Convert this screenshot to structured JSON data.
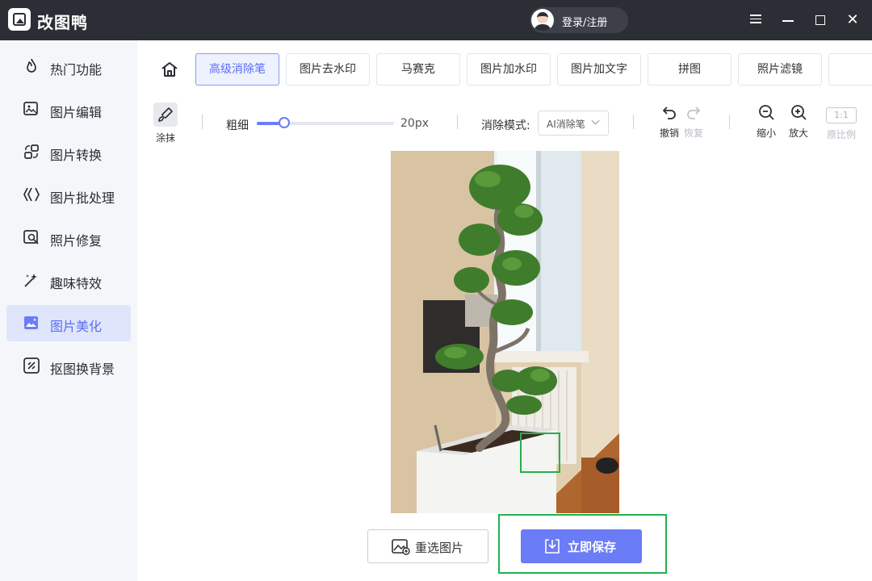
{
  "app": {
    "title": "改图鸭",
    "login_label": "登录/注册"
  },
  "sidebar": {
    "items": [
      {
        "label": "热门功能",
        "icon": "flame-icon"
      },
      {
        "label": "图片编辑",
        "icon": "image-edit-icon"
      },
      {
        "label": "图片转换",
        "icon": "convert-icon"
      },
      {
        "label": "图片批处理",
        "icon": "batch-icon"
      },
      {
        "label": "照片修复",
        "icon": "photo-repair-icon"
      },
      {
        "label": "趣味特效",
        "icon": "magic-wand-icon"
      },
      {
        "label": "图片美化",
        "icon": "beautify-icon",
        "active": true
      },
      {
        "label": "抠图换背景",
        "icon": "cutout-icon"
      }
    ]
  },
  "tabs": [
    "高级消除笔",
    "图片去水印",
    "马赛克",
    "图片加水印",
    "图片加文字",
    "拼图",
    "照片滤镜"
  ],
  "active_tab": "高级消除笔",
  "toolbar": {
    "smear_label": "涂抹",
    "thickness_label": "粗细",
    "thickness_value": "20px",
    "thickness_fraction": 0.2,
    "mode_label": "消除模式:",
    "mode_value": "AI消除笔",
    "undo_label": "撤销",
    "redo_label": "恢复",
    "zoom_out_label": "缩小",
    "zoom_in_label": "放大",
    "ratio_text": "1:1",
    "original_label": "原比例"
  },
  "actions": {
    "reselect_label": "重选图片",
    "save_label": "立即保存"
  },
  "colors": {
    "accent": "#6b7cf7",
    "titlebar": "#2b2e35",
    "highlight": "#22b14c"
  }
}
